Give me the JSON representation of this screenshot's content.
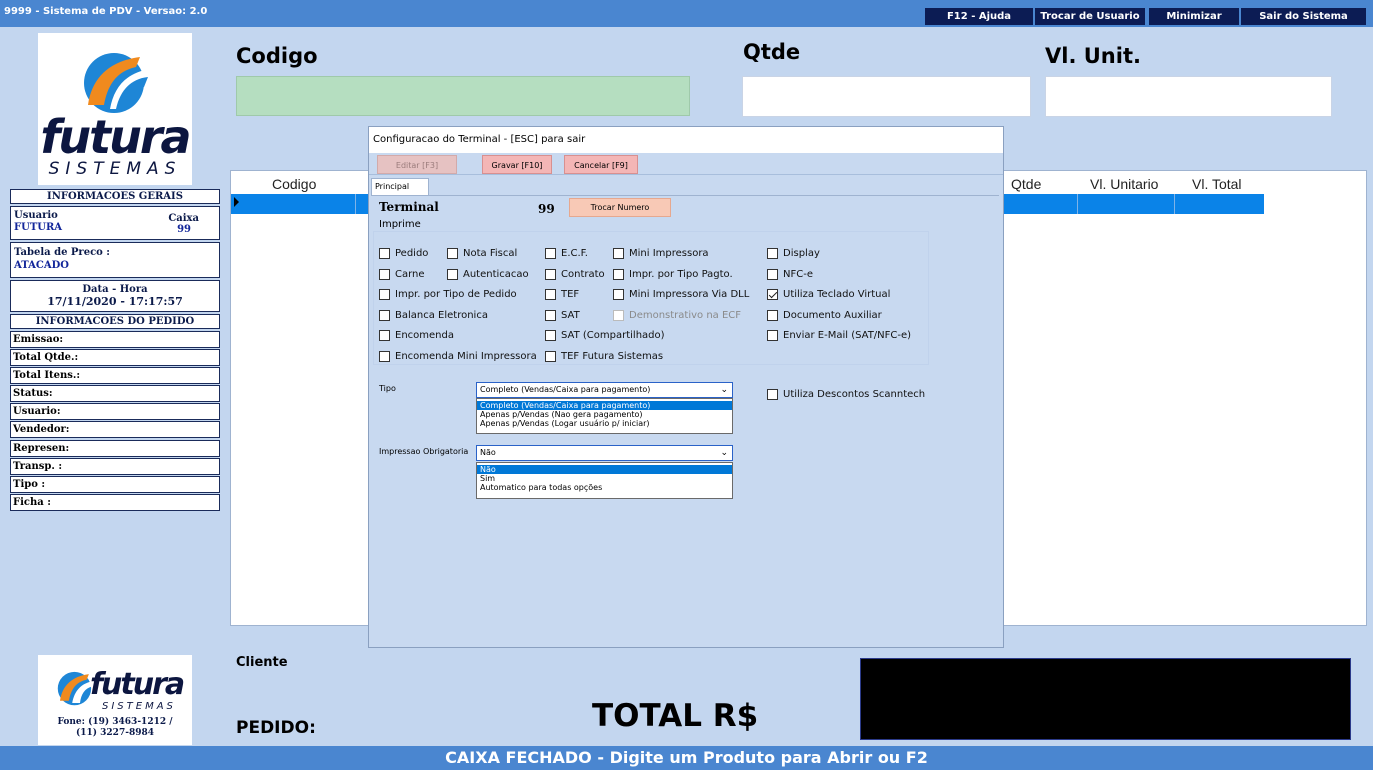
{
  "window": {
    "title": "9999 - Sistema de PDV - Versao: 2.0"
  },
  "title_buttons": [
    {
      "label": "F12 - Ajuda"
    },
    {
      "label": "Trocar de Usuario"
    },
    {
      "label": "Minimizar"
    },
    {
      "label": "Sair do Sistema"
    }
  ],
  "logo": {
    "wordmark": "futura",
    "tagline": "SISTEMAS"
  },
  "info": {
    "header": "INFORMACOES GERAIS",
    "usuario_label": "Usuario",
    "usuario_value": "FUTURA",
    "caixa_label": "Caixa",
    "caixa_value": "99",
    "tabela_label": "Tabela de Preco :",
    "tabela_value": "ATACADO",
    "datahora_label": "Data - Hora",
    "datahora_value": "17/11/2020 - 17:17:57",
    "pedido_header": "INFORMACOES DO PEDIDO",
    "fields": [
      "Emissao:",
      "Total Qtde.:",
      "Total Itens.:",
      "Status:",
      "Usuario:",
      "Vendedor:",
      "Represen:",
      "Transp. :",
      "Tipo :",
      "Ficha :"
    ]
  },
  "bottom_logo": {
    "wordmark": "futura",
    "tagline": "SISTEMAS",
    "phone1": "Fone: (19) 3463-1212 /",
    "phone2": "(11) 3227-8984"
  },
  "main": {
    "codigo_label": "Codigo",
    "qtde_label": "Qtde",
    "vlunit_label": "Vl. Unit."
  },
  "grid": {
    "headers": [
      "Codigo",
      "Qtde",
      "Vl. Unitario",
      "Vl. Total"
    ]
  },
  "footer": {
    "cliente_label": "Cliente",
    "pedido_label": "PEDIDO:",
    "total_label": "TOTAL R$"
  },
  "status_bar": {
    "text": "CAIXA FECHADO - Digite um Produto para Abrir ou F2"
  },
  "dialog": {
    "title": "Configuracao do Terminal - [ESC] para sair",
    "buttons": {
      "editar": "Editar [F3]",
      "gravar": "Gravar [F10]",
      "cancelar": "Cancelar [F9]"
    },
    "tab": "Principal",
    "terminal_label": "Terminal",
    "terminal_value": "99",
    "trocar_numero": "Trocar Numero",
    "imprime_label": "Imprime",
    "checkboxes": {
      "pedido": {
        "label": "Pedido",
        "checked": false
      },
      "nota_fiscal": {
        "label": "Nota Fiscal",
        "checked": false
      },
      "ecf": {
        "label": "E.C.F.",
        "checked": false
      },
      "mini_impressora": {
        "label": "Mini Impressora",
        "checked": false
      },
      "display": {
        "label": "Display",
        "checked": false
      },
      "carne": {
        "label": "Carne",
        "checked": false
      },
      "autenticacao": {
        "label": "Autenticacao",
        "checked": false
      },
      "contrato": {
        "label": "Contrato",
        "checked": false
      },
      "impr_tipo_pagto": {
        "label": "Impr. por Tipo Pagto.",
        "checked": false
      },
      "nfce": {
        "label": "NFC-e",
        "checked": false
      },
      "impr_tipo_pedido": {
        "label": "Impr. por Tipo de Pedido",
        "checked": false
      },
      "tef": {
        "label": "TEF",
        "checked": false
      },
      "mini_impressora_dll": {
        "label": "Mini Impressora Via DLL",
        "checked": false
      },
      "teclado_virtual": {
        "label": "Utiliza Teclado Virtual",
        "checked": true
      },
      "balanca": {
        "label": "Balanca Eletronica",
        "checked": false
      },
      "sat": {
        "label": "SAT",
        "checked": false
      },
      "demonstrativo_ecf": {
        "label": "Demonstrativo na ECF",
        "checked": false
      },
      "documento_auxiliar": {
        "label": "Documento Auxiliar",
        "checked": false
      },
      "encomenda": {
        "label": "Encomenda",
        "checked": false
      },
      "sat_compartilhado": {
        "label": "SAT (Compartilhado)",
        "checked": false
      },
      "enviar_email": {
        "label": "Enviar E-Mail (SAT/NFC-e)",
        "checked": false
      },
      "encomenda_mini": {
        "label": "Encomenda Mini Impressora",
        "checked": false
      },
      "tef_futura": {
        "label": "TEF Futura Sistemas",
        "checked": false
      },
      "descontos_scanntech": {
        "label": "Utiliza Descontos Scanntech",
        "checked": false
      }
    },
    "tipo_label": "Tipo",
    "tipo_value": "Completo (Vendas/Caixa para pagamento)",
    "tipo_options": [
      "Completo (Vendas/Caixa para pagamento)",
      "Apenas p/Vendas (Nao gera pagamento)",
      "Apenas p/Vendas (Logar usuário p/ iniciar)"
    ],
    "impressao_label": "Impressao Obrigatoria",
    "impressao_value": "Não",
    "impressao_options": [
      "Não",
      "Sim",
      "Automatico para todas opções"
    ]
  },
  "colors": {
    "titlebar": "#4a86d0",
    "title_button": "#0c1c54",
    "background": "#c3d6ef",
    "selected_row": "#0a83e8",
    "codigo_field": "#b5dec0",
    "gravar_button": "#f4b6b6",
    "trocar_button": "#f8c9b6",
    "total_box": "#000000"
  }
}
